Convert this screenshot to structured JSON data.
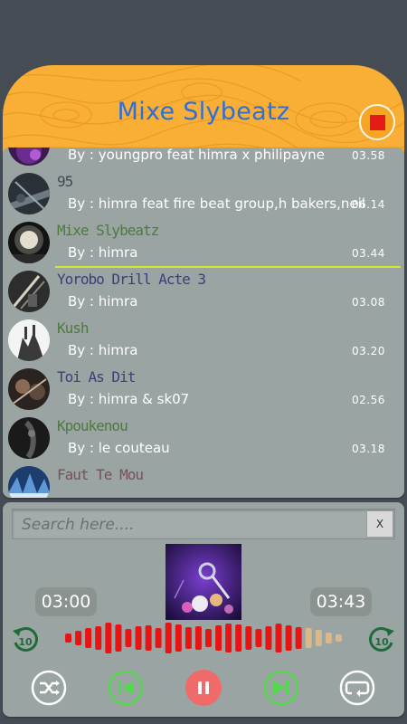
{
  "app": {
    "title": "Mixe Slybeatz",
    "accent_color": "#f9ae35",
    "title_color": "#2f6fd6",
    "stop_icon": "stop-icon"
  },
  "playlist": [
    {
      "title": "",
      "artist": "By : youngpro feat himra x philipayne",
      "duration": "03.58",
      "title_color": "#3b3f7a",
      "thumb": "purple"
    },
    {
      "title": "95",
      "artist": "By : himra feat fire beat group,h bakers,neil",
      "duration": "06.14",
      "title_color": "#3f4a55",
      "thumb": "guitar"
    },
    {
      "title": "Mixe Slybeatz",
      "artist": "By : himra",
      "duration": "03.44",
      "title_color": "#4e7a3e",
      "thumb": "stage",
      "active": true
    },
    {
      "title": "Yorobo Drill Acte 3",
      "artist": "By : himra",
      "duration": "03.08",
      "title_color": "#3b3f7a",
      "thumb": "bass"
    },
    {
      "title": "Kush",
      "artist": "By : himra",
      "duration": "03.20",
      "title_color": "#4e7a3e",
      "thumb": "crowd"
    },
    {
      "title": "Toi As Dit",
      "artist": "By : himra & sk07",
      "duration": "02.56",
      "title_color": "#3b3f7a",
      "thumb": "violin"
    },
    {
      "title": "Kpoukenou",
      "artist": "By : le couteau",
      "duration": "03.18",
      "title_color": "#4e7a3e",
      "thumb": "dark"
    },
    {
      "title": "Faut Te Mou",
      "artist": "",
      "duration": "",
      "title_color": "#7a4f5a",
      "thumb": "concert"
    }
  ],
  "player": {
    "search_placeholder": "Search here....",
    "clear_label": "X",
    "current_time": "03:00",
    "total_time": "03:43",
    "progress": 0.84,
    "skip_back_label": "10",
    "skip_forward_label": "10",
    "controls": [
      "shuffle-icon",
      "previous-icon",
      "pause-icon",
      "next-icon",
      "repeat-icon"
    ],
    "played_color": "#e81414",
    "unplayed_color": "#d9b98c",
    "skip_color": "#1f6b3a",
    "nav_color": "#52d84b",
    "pause_color": "#f06a6a"
  }
}
